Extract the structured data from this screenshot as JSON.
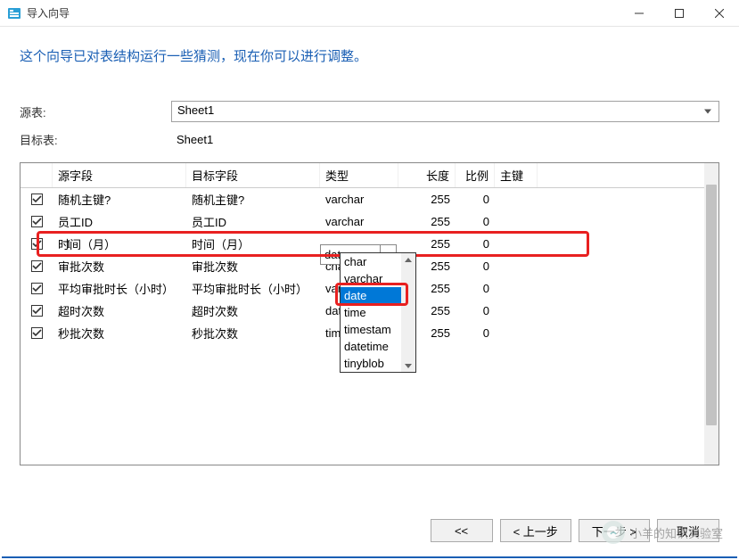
{
  "window": {
    "title": "导入向导"
  },
  "instruction": "这个向导已对表结构运行一些猜测，现在你可以进行调整。",
  "labels": {
    "source_table": "源表:",
    "target_table": "目标表:"
  },
  "source_table": {
    "selected": "Sheet1"
  },
  "target_table": {
    "value": "Sheet1"
  },
  "columns": {
    "source_field": "源字段",
    "target_field": "目标字段",
    "type": "类型",
    "length": "长度",
    "scale": "比例",
    "pk": "主键"
  },
  "rows": [
    {
      "checked": true,
      "source": "随机主键?",
      "target": "随机主键?",
      "type": "varchar",
      "length": 255,
      "scale": 0
    },
    {
      "checked": true,
      "source": "员工ID",
      "target": "员工ID",
      "type": "varchar",
      "length": 255,
      "scale": 0
    },
    {
      "checked": true,
      "source": "时间（月）",
      "target": "时间（月）",
      "type": "date",
      "length": 255,
      "scale": 0,
      "editing": true
    },
    {
      "checked": true,
      "source": "审批次数",
      "target": "审批次数",
      "type": "char",
      "length": 255,
      "scale": 0
    },
    {
      "checked": true,
      "source": "平均审批时长（小时）",
      "target": "平均审批时长（小时）",
      "type": "varchar",
      "length": 255,
      "scale": 0
    },
    {
      "checked": true,
      "source": "超时次数",
      "target": "超时次数",
      "type": "date",
      "length": 255,
      "scale": 0
    },
    {
      "checked": true,
      "source": "秒批次数",
      "target": "秒批次数",
      "type": "time",
      "length": 255,
      "scale": 0
    }
  ],
  "type_dropdown": {
    "options": [
      "char",
      "varchar",
      "date",
      "time",
      "timestamp",
      "datetime",
      "tinyblob"
    ],
    "selected": "date"
  },
  "buttons": {
    "first": "<<",
    "prev": "< 上一步",
    "next": "下一步 >",
    "cancel": "取消"
  },
  "watermark": "小羊的知识实验室"
}
